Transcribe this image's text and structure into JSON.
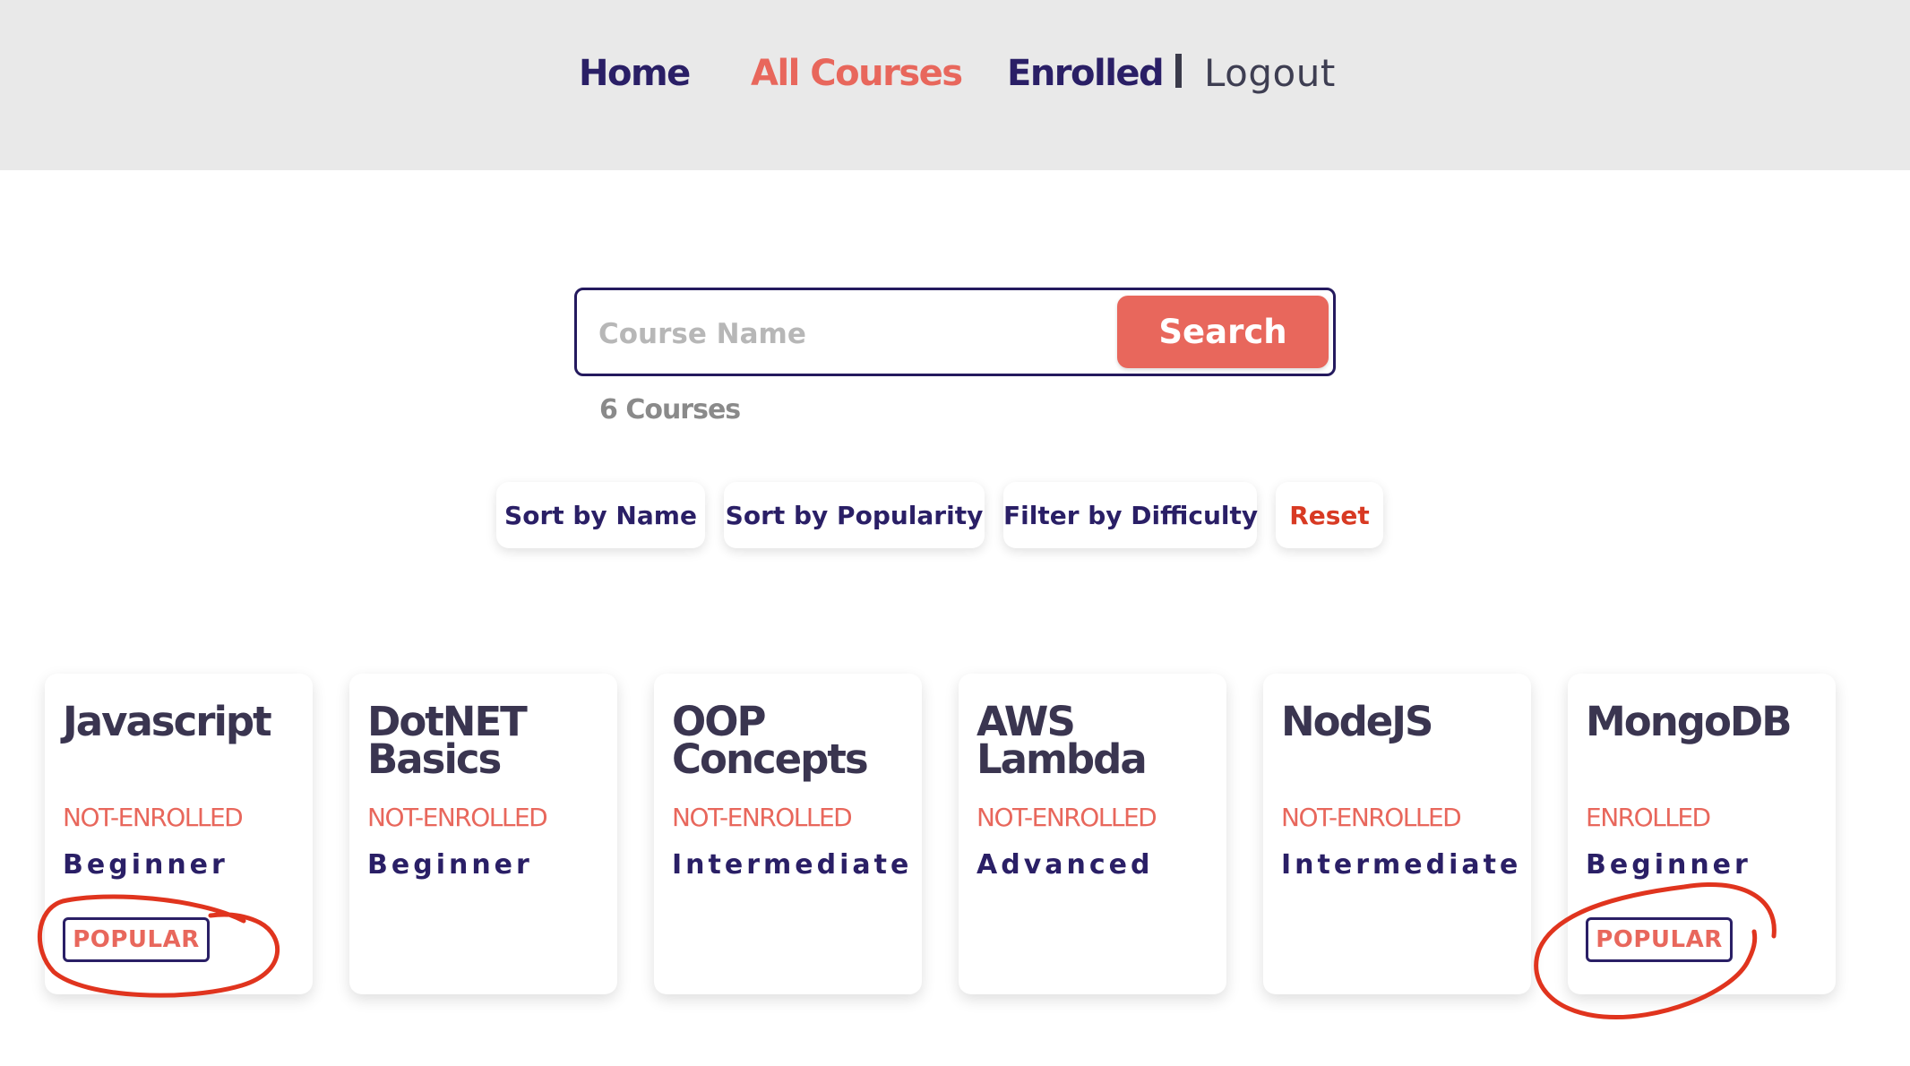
{
  "nav": {
    "home": "Home",
    "all_courses": "All Courses",
    "enrolled": "Enrolled",
    "logout": "Logout"
  },
  "search": {
    "placeholder": "Course Name",
    "value": "",
    "button_label": "Search",
    "result_count": "6 Courses"
  },
  "controls": {
    "sort_by_name": "Sort by Name",
    "sort_by_popularity": "Sort by Popularity",
    "filter_by_difficulty": "Filter by Difficulty",
    "reset": "Reset"
  },
  "courses": [
    {
      "title": "Javascript",
      "status": "NOT-ENROLLED",
      "level": "Beginner",
      "badge": "POPULAR"
    },
    {
      "title": "DotNET Basics",
      "status": "NOT-ENROLLED",
      "level": "Beginner",
      "badge": ""
    },
    {
      "title": "OOP Concepts",
      "status": "NOT-ENROLLED",
      "level": "Intermediate",
      "badge": ""
    },
    {
      "title": "AWS Lambda",
      "status": "NOT-ENROLLED",
      "level": "Advanced",
      "badge": ""
    },
    {
      "title": "NodeJS",
      "status": "NOT-ENROLLED",
      "level": "Intermediate",
      "badge": ""
    },
    {
      "title": "MongoDB",
      "status": "ENROLLED",
      "level": "Beginner",
      "badge": "POPULAR"
    }
  ],
  "colors": {
    "primary": "#2a1f66",
    "accent": "#e8675c",
    "reset": "#d83a23",
    "annotation": "#e0341e",
    "header_bg": "#e9e9e9"
  }
}
